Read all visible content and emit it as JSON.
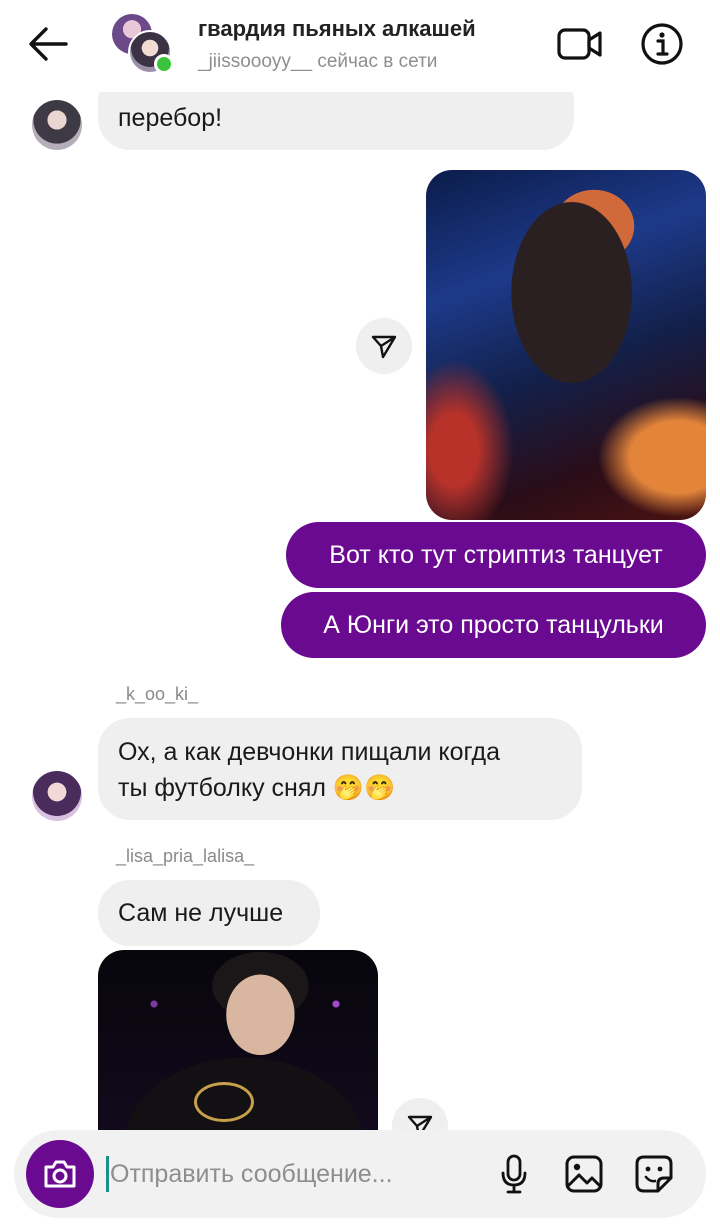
{
  "header": {
    "title": "гвардия пьяных алкашей",
    "status": "_jiissoooyy__ сейчас в сети",
    "back_icon": "arrow-left-icon",
    "video_icon": "video-camera-icon",
    "info_icon": "info-icon",
    "online_color": "#3bc43b"
  },
  "messages": {
    "m1_text": "перебор!",
    "m2_text": "Вот кто тут стриптиз танцует",
    "m3_text": "А Юнги это просто танцульки",
    "m4_sender": "_k_oo_ki_",
    "m4_line1": "Ох, а как девчонки пищали когда",
    "m4_line2": "ты футболку снял 🤭🤭",
    "m5_sender": "_lisa_pria_lalisa_",
    "m5_text": "Сам не лучше"
  },
  "composer": {
    "placeholder": "Отправить сообщение...",
    "camera_icon": "camera-icon",
    "mic_icon": "microphone-icon",
    "gallery_icon": "image-icon",
    "sticker_icon": "sticker-icon"
  },
  "colors": {
    "outgoing_bubble": "#6a0a91",
    "incoming_bubble": "#efefef",
    "camera_button": "#6a0a91"
  }
}
